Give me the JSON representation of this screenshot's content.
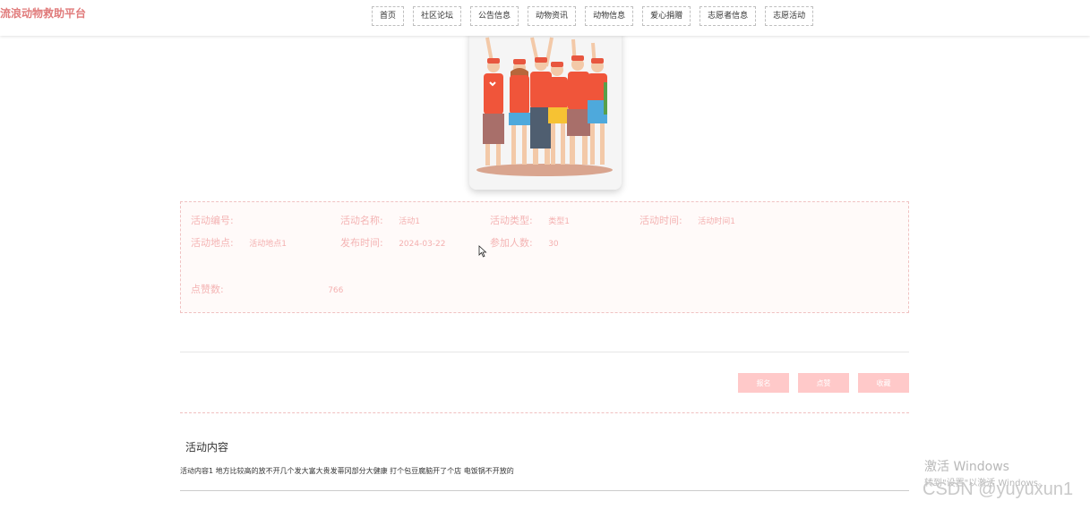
{
  "header": {
    "logo": "流浪动物救助平台",
    "nav": [
      "首页",
      "社区论坛",
      "公告信息",
      "动物资讯",
      "动物信息",
      "爱心捐赠",
      "志愿者信息",
      "志愿活动"
    ]
  },
  "activity": {
    "id_label": "活动编号:",
    "id_value": "",
    "name_label": "活动名称:",
    "name_value": "活动1",
    "type_label": "活动类型:",
    "type_value": "类型1",
    "time_label": "活动时间:",
    "time_value": "活动时间1",
    "place_label": "活动地点:",
    "place_value": "活动地点1",
    "publish_label": "发布时间:",
    "publish_value": "2024-03-22",
    "count_label": "参加人数:",
    "count_value": "30",
    "likes_label": "点赞数:",
    "likes_value": "766"
  },
  "actions": {
    "signup": "报名",
    "like": "点赞",
    "favorite": "收藏"
  },
  "content": {
    "title": "活动内容",
    "text": "活动内容1 地方比较高的放不开几个发大富大贵发蒂冈部分大健康 打个包豆腐脑开了个店 电饭锅不开放的"
  },
  "overlay": {
    "windows_title": "激活 Windows",
    "windows_sub": "转到\"设置\"以激活 Windows。",
    "csdn": "CSDN @yuyuxun1"
  },
  "colors": {
    "accent": "#e07a7a",
    "button": "#ffc9c9",
    "panel_bg": "#fffaf9"
  }
}
